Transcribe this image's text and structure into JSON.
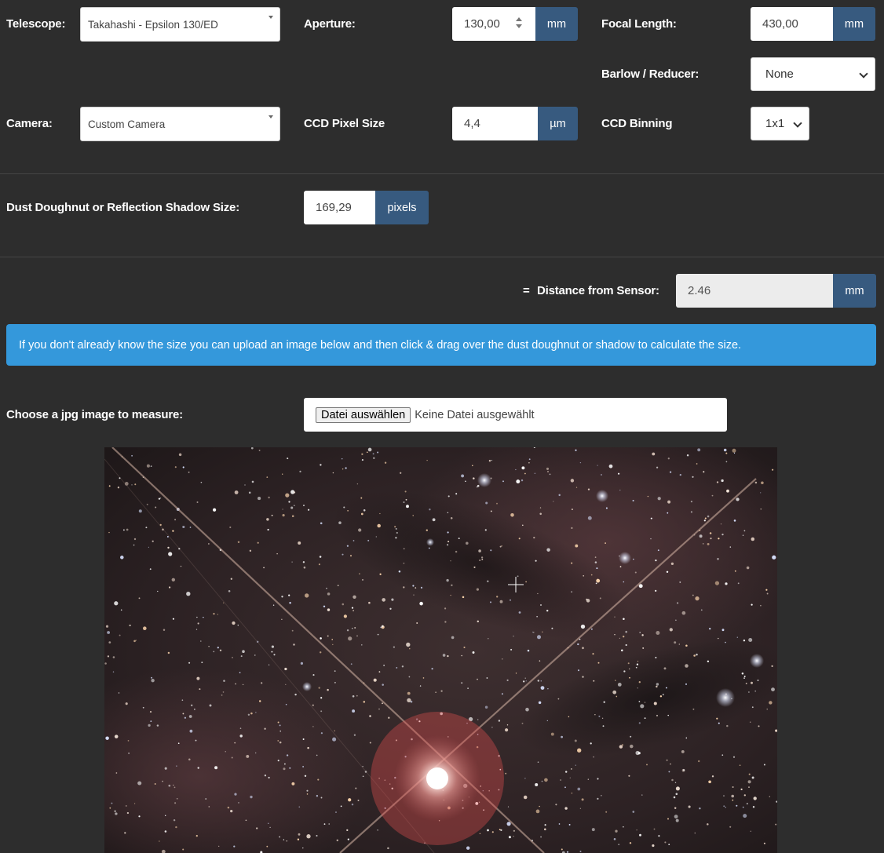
{
  "telescope": {
    "label": "Telescope:",
    "value": "Takahashi - Epsilon 130/ED"
  },
  "aperture": {
    "label": "Aperture:",
    "value": "130,00",
    "unit": "mm"
  },
  "focal_length": {
    "label": "Focal Length:",
    "value": "430,00",
    "unit": "mm"
  },
  "barlow": {
    "label": "Barlow / Reducer:",
    "value": "None"
  },
  "camera": {
    "label": "Camera:",
    "value": "Custom Camera"
  },
  "pixel_size": {
    "label": "CCD Pixel Size",
    "value": "4,4",
    "unit": "µm"
  },
  "binning": {
    "label": "CCD Binning",
    "value": "1x1"
  },
  "doughnut": {
    "label": "Dust Doughnut or Reflection Shadow Size:",
    "value": "169,29",
    "unit": "pixels"
  },
  "distance": {
    "prefix": "=",
    "label": "Distance from Sensor:",
    "value": "2.46",
    "unit": "mm"
  },
  "info_text": "If you don't already know the size you can upload an image below and then click & drag over the dust doughnut or shadow to calculate the size.",
  "upload": {
    "label": "Choose a jpg image to measure:",
    "button": "Datei auswählen",
    "status": "Keine Datei ausgewählt"
  },
  "colors": {
    "accent": "#375a7f",
    "info": "#3498db",
    "background": "#2d2d2d",
    "selection": "#e05050"
  },
  "image": {
    "icon": "crosshair-icon"
  }
}
